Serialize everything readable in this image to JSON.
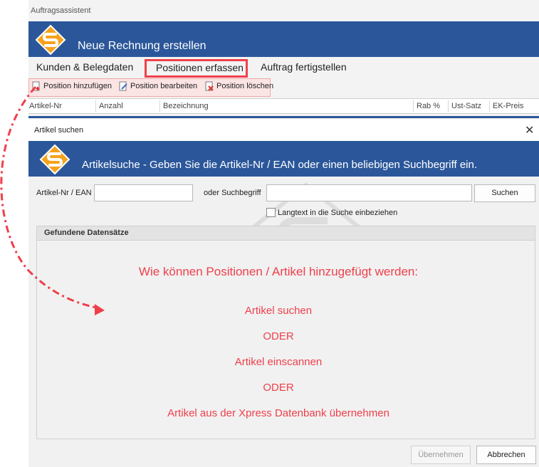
{
  "window": {
    "title": "Auftragsassistent",
    "banner_title": "Neue Rechnung erstellen"
  },
  "tabs": [
    {
      "label": "Kunden & Belegdaten"
    },
    {
      "label": "Positionen erfassen",
      "highlighted": true
    },
    {
      "label": "Auftrag fertigstellen"
    }
  ],
  "toolbar": {
    "add": "Position hinzufügen",
    "edit": "Position bearbeiten",
    "delete": "Position löschen"
  },
  "grid": {
    "columns": [
      "Artikel-Nr",
      "Anzahl",
      "Bezeichnung",
      "Rab %",
      "Ust-Satz",
      "EK-Preis"
    ]
  },
  "dialog": {
    "title": "Artikel suchen",
    "banner_title": "Artikelsuche - Geben Sie die Artikel-Nr / EAN oder einen beliebigen Suchbegriff ein.",
    "ean_label": "Artikel-Nr / EAN",
    "ean_value": "",
    "search_label": "oder Suchbegriff",
    "search_value": "",
    "search_button": "Suchen",
    "longtext_checkbox": "Langtext in die Suche einbeziehen",
    "results_title": "Gefundene Datensätze",
    "hint_headline": "Wie können Positionen / Artikel hinzugefügt werden:",
    "hint_lines": [
      "Artikel suchen",
      "ODER",
      "Artikel einscannen",
      "ODER",
      "Artikel aus der Xpress Datenbank übernehmen"
    ],
    "ok_button": "Übernehmen",
    "cancel_button": "Abbrechen"
  },
  "colors": {
    "banner": "#2b579a",
    "highlight": "#f0404a",
    "hint_text": "#ef3f4b"
  }
}
